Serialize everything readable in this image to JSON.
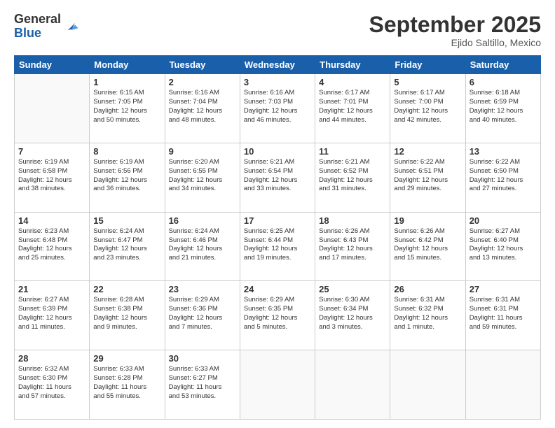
{
  "logo": {
    "general": "General",
    "blue": "Blue"
  },
  "header": {
    "month": "September 2025",
    "location": "Ejido Saltillo, Mexico"
  },
  "days": [
    "Sunday",
    "Monday",
    "Tuesday",
    "Wednesday",
    "Thursday",
    "Friday",
    "Saturday"
  ],
  "weeks": [
    [
      {
        "day": "",
        "content": ""
      },
      {
        "day": "1",
        "content": "Sunrise: 6:15 AM\nSunset: 7:05 PM\nDaylight: 12 hours\nand 50 minutes."
      },
      {
        "day": "2",
        "content": "Sunrise: 6:16 AM\nSunset: 7:04 PM\nDaylight: 12 hours\nand 48 minutes."
      },
      {
        "day": "3",
        "content": "Sunrise: 6:16 AM\nSunset: 7:03 PM\nDaylight: 12 hours\nand 46 minutes."
      },
      {
        "day": "4",
        "content": "Sunrise: 6:17 AM\nSunset: 7:01 PM\nDaylight: 12 hours\nand 44 minutes."
      },
      {
        "day": "5",
        "content": "Sunrise: 6:17 AM\nSunset: 7:00 PM\nDaylight: 12 hours\nand 42 minutes."
      },
      {
        "day": "6",
        "content": "Sunrise: 6:18 AM\nSunset: 6:59 PM\nDaylight: 12 hours\nand 40 minutes."
      }
    ],
    [
      {
        "day": "7",
        "content": "Sunrise: 6:19 AM\nSunset: 6:58 PM\nDaylight: 12 hours\nand 38 minutes."
      },
      {
        "day": "8",
        "content": "Sunrise: 6:19 AM\nSunset: 6:56 PM\nDaylight: 12 hours\nand 36 minutes."
      },
      {
        "day": "9",
        "content": "Sunrise: 6:20 AM\nSunset: 6:55 PM\nDaylight: 12 hours\nand 34 minutes."
      },
      {
        "day": "10",
        "content": "Sunrise: 6:21 AM\nSunset: 6:54 PM\nDaylight: 12 hours\nand 33 minutes."
      },
      {
        "day": "11",
        "content": "Sunrise: 6:21 AM\nSunset: 6:52 PM\nDaylight: 12 hours\nand 31 minutes."
      },
      {
        "day": "12",
        "content": "Sunrise: 6:22 AM\nSunset: 6:51 PM\nDaylight: 12 hours\nand 29 minutes."
      },
      {
        "day": "13",
        "content": "Sunrise: 6:22 AM\nSunset: 6:50 PM\nDaylight: 12 hours\nand 27 minutes."
      }
    ],
    [
      {
        "day": "14",
        "content": "Sunrise: 6:23 AM\nSunset: 6:48 PM\nDaylight: 12 hours\nand 25 minutes."
      },
      {
        "day": "15",
        "content": "Sunrise: 6:24 AM\nSunset: 6:47 PM\nDaylight: 12 hours\nand 23 minutes."
      },
      {
        "day": "16",
        "content": "Sunrise: 6:24 AM\nSunset: 6:46 PM\nDaylight: 12 hours\nand 21 minutes."
      },
      {
        "day": "17",
        "content": "Sunrise: 6:25 AM\nSunset: 6:44 PM\nDaylight: 12 hours\nand 19 minutes."
      },
      {
        "day": "18",
        "content": "Sunrise: 6:26 AM\nSunset: 6:43 PM\nDaylight: 12 hours\nand 17 minutes."
      },
      {
        "day": "19",
        "content": "Sunrise: 6:26 AM\nSunset: 6:42 PM\nDaylight: 12 hours\nand 15 minutes."
      },
      {
        "day": "20",
        "content": "Sunrise: 6:27 AM\nSunset: 6:40 PM\nDaylight: 12 hours\nand 13 minutes."
      }
    ],
    [
      {
        "day": "21",
        "content": "Sunrise: 6:27 AM\nSunset: 6:39 PM\nDaylight: 12 hours\nand 11 minutes."
      },
      {
        "day": "22",
        "content": "Sunrise: 6:28 AM\nSunset: 6:38 PM\nDaylight: 12 hours\nand 9 minutes."
      },
      {
        "day": "23",
        "content": "Sunrise: 6:29 AM\nSunset: 6:36 PM\nDaylight: 12 hours\nand 7 minutes."
      },
      {
        "day": "24",
        "content": "Sunrise: 6:29 AM\nSunset: 6:35 PM\nDaylight: 12 hours\nand 5 minutes."
      },
      {
        "day": "25",
        "content": "Sunrise: 6:30 AM\nSunset: 6:34 PM\nDaylight: 12 hours\nand 3 minutes."
      },
      {
        "day": "26",
        "content": "Sunrise: 6:31 AM\nSunset: 6:32 PM\nDaylight: 12 hours\nand 1 minute."
      },
      {
        "day": "27",
        "content": "Sunrise: 6:31 AM\nSunset: 6:31 PM\nDaylight: 11 hours\nand 59 minutes."
      }
    ],
    [
      {
        "day": "28",
        "content": "Sunrise: 6:32 AM\nSunset: 6:30 PM\nDaylight: 11 hours\nand 57 minutes."
      },
      {
        "day": "29",
        "content": "Sunrise: 6:33 AM\nSunset: 6:28 PM\nDaylight: 11 hours\nand 55 minutes."
      },
      {
        "day": "30",
        "content": "Sunrise: 6:33 AM\nSunset: 6:27 PM\nDaylight: 11 hours\nand 53 minutes."
      },
      {
        "day": "",
        "content": ""
      },
      {
        "day": "",
        "content": ""
      },
      {
        "day": "",
        "content": ""
      },
      {
        "day": "",
        "content": ""
      }
    ]
  ]
}
